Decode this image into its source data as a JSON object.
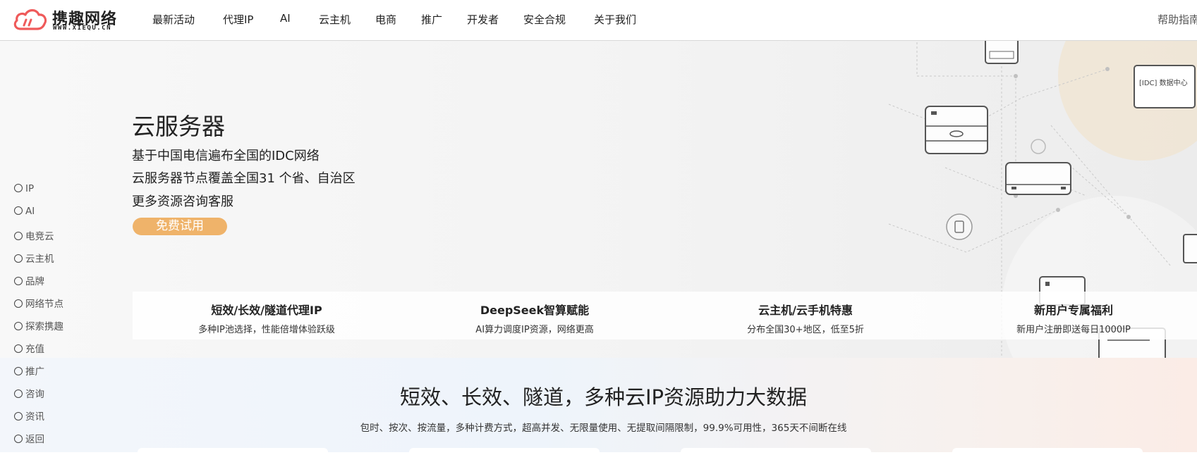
{
  "brand": {
    "name": "携趣网络",
    "domain": "WWW.XIEQU.CN",
    "accent_color": "#ef5a5a"
  },
  "nav": {
    "items": [
      "最新活动",
      "代理IP",
      "AI",
      "云主机",
      "电商",
      "推广",
      "开发者",
      "安全合规",
      "关于我们"
    ],
    "help": "帮助指南"
  },
  "hero": {
    "title": "云服务器",
    "lines": [
      "基于中国电信遍布全国的IDC网络",
      "云服务器节点覆盖全国31 个省、自治区",
      "更多资源咨询客服"
    ],
    "cta": "免费试用",
    "cta_color": "#efb36a"
  },
  "features": [
    {
      "title": "短效/长效/隧道代理IP",
      "desc": "多种IP池选择，性能倍增体验跃级"
    },
    {
      "title": "DeepSeek智算赋能",
      "desc": "AI算力调度IP资源，网络更高"
    },
    {
      "title": "云主机/云手机特惠",
      "desc": "分布全国30+地区，低至5折"
    },
    {
      "title": "新用户专属福利",
      "desc": "新用户注册即送每日1000IP"
    }
  ],
  "sidenav": {
    "items": [
      "IP",
      "AI",
      "电竞云",
      "云主机",
      "品牌",
      "网络节点",
      "探索携趣",
      "充值",
      "推广",
      "咨询",
      "资讯",
      "返回"
    ]
  },
  "section2": {
    "title": "短效、长效、隧道，多种云IP资源助力大数据",
    "subtitle": "包时、按次、按流量，多种计费方式，超高并发、无限量使用、无提取间隔限制，99.9%可用性，365天不间断在线"
  },
  "illustration": {
    "tag_text": "[IDC] 数据中心"
  }
}
